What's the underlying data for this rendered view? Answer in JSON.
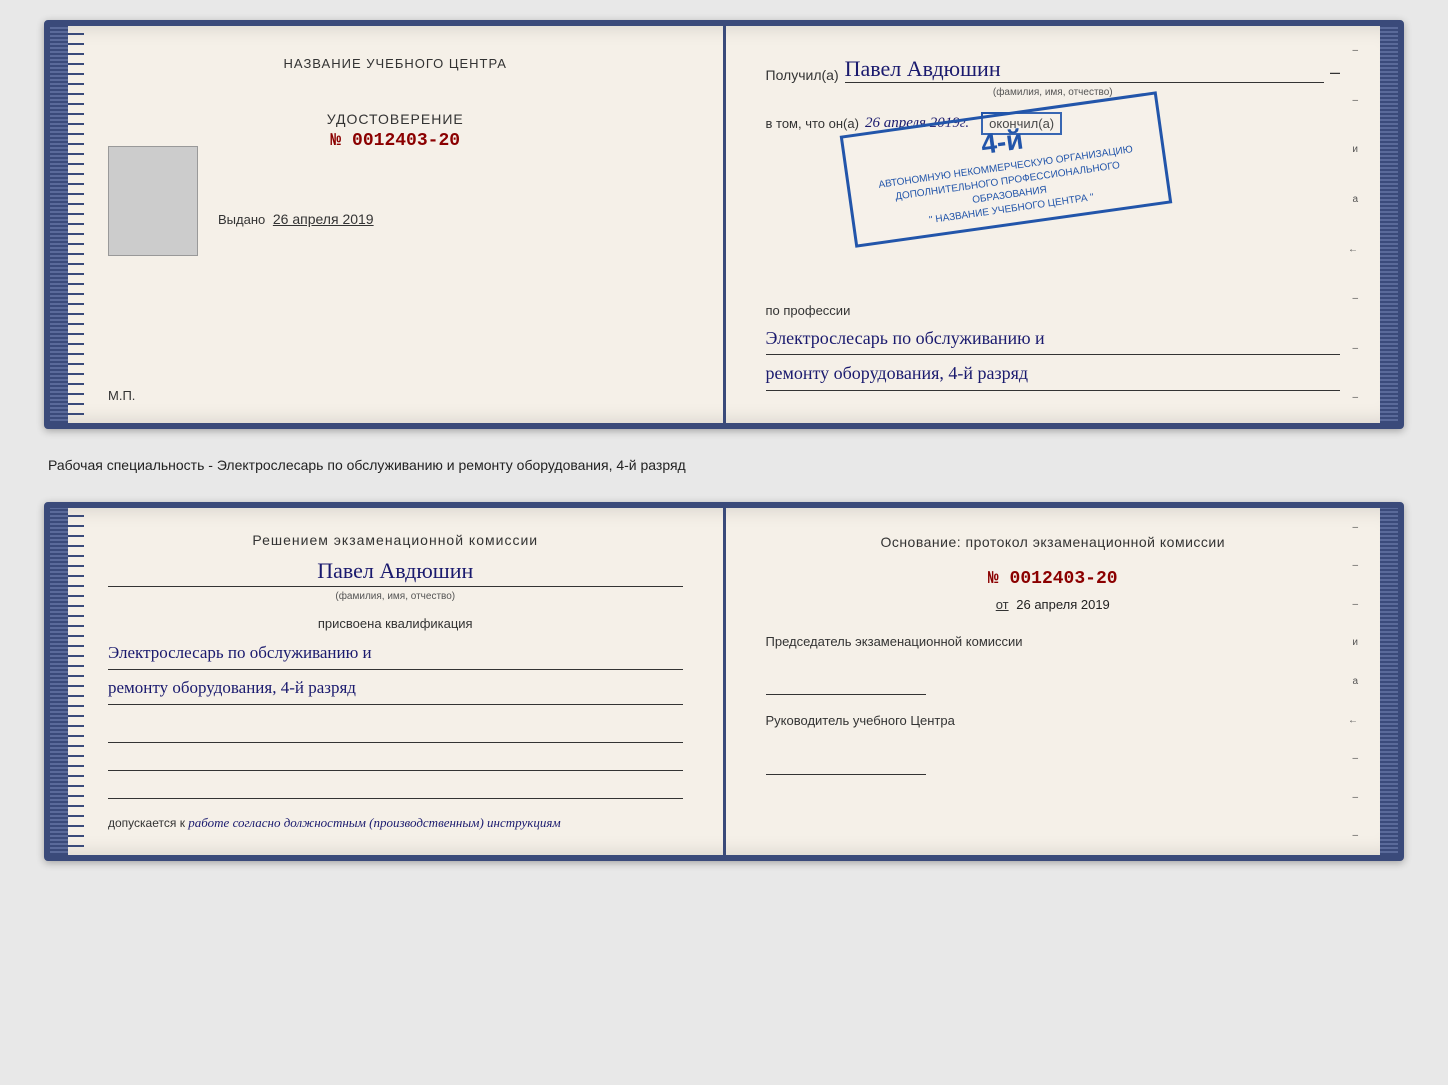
{
  "top_doc": {
    "left": {
      "section_label": "НАЗВАНИЕ УЧЕБНОГО ЦЕНТРА",
      "title": "УДОСТОВЕРЕНИЕ",
      "number_prefix": "№",
      "number": "0012403-20",
      "vydano_label": "Выдано",
      "vydano_date": "26 апреля 2019",
      "mp_label": "М.П."
    },
    "right": {
      "poluchil_label": "Получил(a)",
      "name": "Павел Авдюшин",
      "fio_label": "(фамилия, имя, отчество)",
      "vtom_label": "в том, что он(а)",
      "date_handwritten": "26 апреля 2019г.",
      "okonchil_label": "окончил(а)",
      "stamp_grade": "4-й",
      "stamp_line1": "АВТОНОМНУЮ НЕКОММЕРЧЕСКУЮ ОРГАНИЗАЦИЮ",
      "stamp_line2": "ДОПОЛНИТЕЛЬНОГО ПРОФЕССИОНАЛЬНОГО ОБРАЗОВАНИЯ",
      "stamp_line3": "\" НАЗВАНИЕ УЧЕБНОГО ЦЕНТРА \"",
      "po_professii": "по профессии",
      "profession_line1": "Электрослесарь по обслуживанию и",
      "profession_line2": "ремонту оборудования, 4-й разряд"
    }
  },
  "between_text": "Рабочая специальность - Электрослесарь по обслуживанию и ремонту оборудования, 4-й разряд",
  "bottom_doc": {
    "left": {
      "resheniem_title": "Решением экзаменационной комиссии",
      "name": "Павел Авдюшин",
      "fio_label": "(фамилия, имя, отчество)",
      "prisvoena_label": "присвоена квалификация",
      "qualification_line1": "Электрослесарь по обслуживанию и",
      "qualification_line2": "ремонту оборудования, 4-й разряд",
      "dopuskaetsya_label": "допускается к",
      "dopuskaetsya_text": "работе согласно должностным (производственным) инструкциям"
    },
    "right": {
      "osnovanie_label": "Основание: протокол экзаменационной комиссии",
      "number_prefix": "№",
      "number": "0012403-20",
      "ot_label": "от",
      "ot_date": "26 апреля 2019",
      "predsedatel_label": "Председатель экзаменационной комиссии",
      "rukovoditel_label": "Руководитель учебного Центра"
    }
  },
  "side_marks": {
    "values": [
      "–",
      "–",
      "и",
      "а",
      "←",
      "–",
      "–",
      "–"
    ]
  }
}
